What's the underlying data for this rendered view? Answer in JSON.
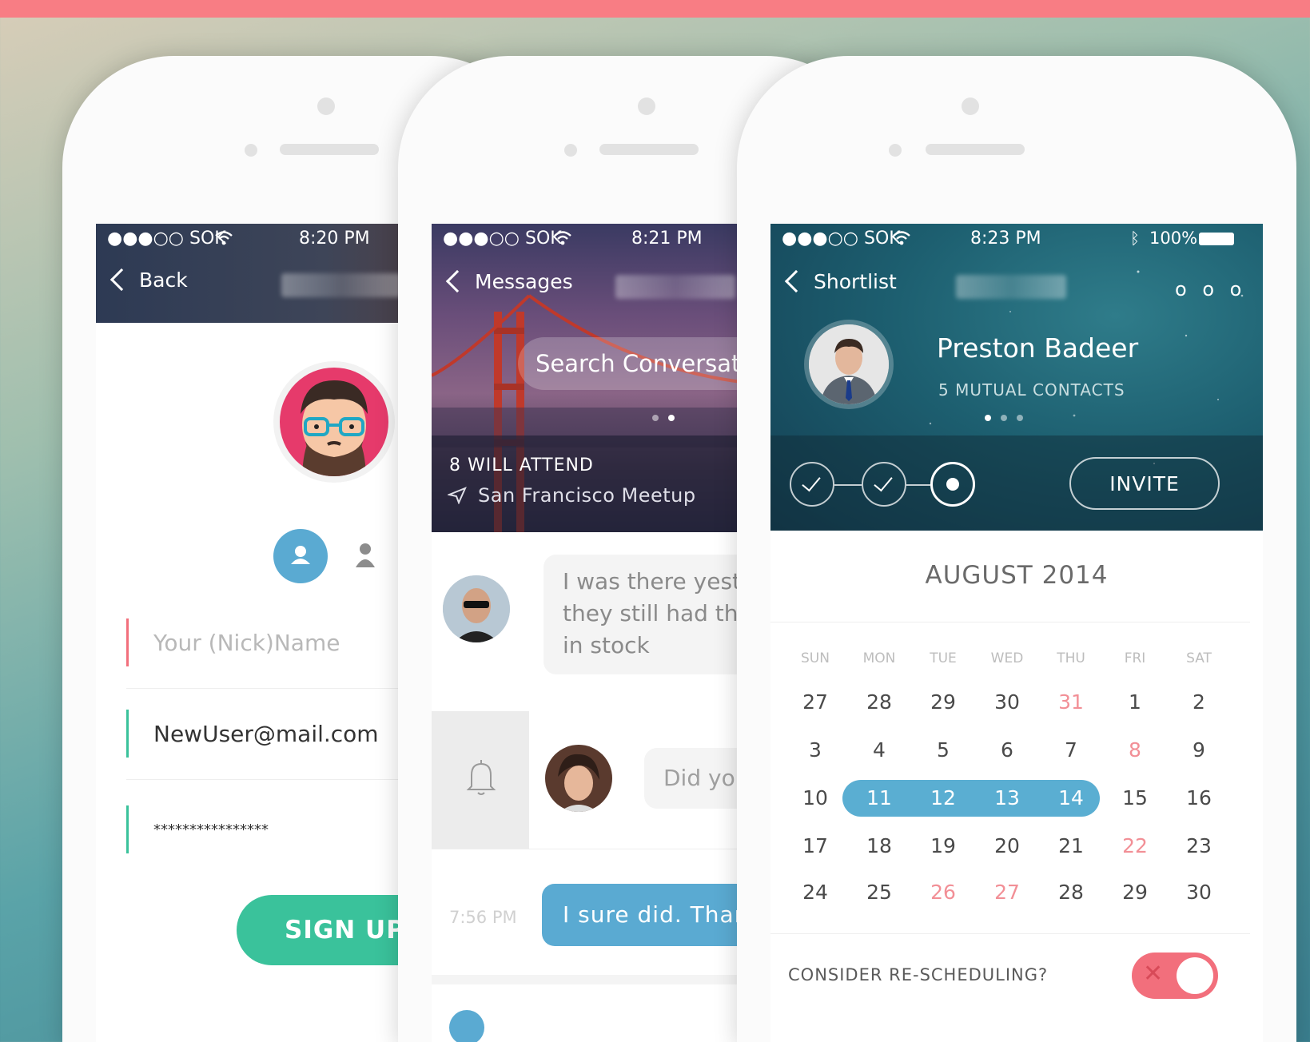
{
  "colors": {
    "top_bar": "#f87d84",
    "signup_green": "#3ac29b",
    "bubble_blue": "#5aaad2",
    "weekend_red": "#f28f96",
    "toggle_red": "#f26f7c"
  },
  "phone1": {
    "status": {
      "signal": "●●●○○ SOK",
      "time": "8:20 PM"
    },
    "nav": {
      "back_label": "Back"
    },
    "fields": {
      "name_placeholder": "Your (Nick)Name",
      "email_value": "NewUser@mail.com",
      "password_value": "****************"
    },
    "signup_label": "SIGN UP"
  },
  "phone2": {
    "status": {
      "signal": "●●●○○ SOK",
      "time": "8:21 PM"
    },
    "nav": {
      "back_label": "Messages"
    },
    "search_placeholder": "Search Conversations",
    "event": {
      "attendance": "8 WILL ATTEND",
      "title": "San Francisco Meetup"
    },
    "messages": [
      {
        "text": [
          "I was there yesterday,",
          "they still had them",
          "in stock"
        ]
      },
      {
        "text": "Did you"
      },
      {
        "time": "7:56 PM",
        "text": "I sure did. Thanks!"
      }
    ]
  },
  "phone3": {
    "status": {
      "signal": "●●●○○ SOK",
      "time": "8:23 PM",
      "battery": "100%"
    },
    "nav": {
      "back_label": "Shortlist",
      "more_label": "o o o"
    },
    "profile": {
      "name": "Preston Badeer",
      "mutual": "5 MUTUAL CONTACTS"
    },
    "invite_label": "INVITE",
    "calendar": {
      "month": "AUGUST 2014",
      "weekdays": [
        "SUN",
        "MON",
        "TUE",
        "WED",
        "THU",
        "FRI",
        "SAT"
      ],
      "weeks": [
        [
          "27",
          "28",
          "29",
          "30",
          "31",
          "1",
          "2"
        ],
        [
          "3",
          "4",
          "5",
          "6",
          "7",
          "8",
          "9"
        ],
        [
          "10",
          "11",
          "12",
          "13",
          "14",
          "15",
          "16"
        ],
        [
          "17",
          "18",
          "19",
          "20",
          "21",
          "22",
          "23"
        ],
        [
          "24",
          "25",
          "26",
          "27",
          "28",
          "29",
          "30"
        ]
      ],
      "highlighted_red": [
        "31",
        "8",
        "22",
        "26",
        "27"
      ],
      "selected_range": [
        "11",
        "12",
        "13",
        "14"
      ]
    },
    "reschedule_label": "CONSIDER RE-SCHEDULING?",
    "reschedule_toggle": "✕"
  }
}
